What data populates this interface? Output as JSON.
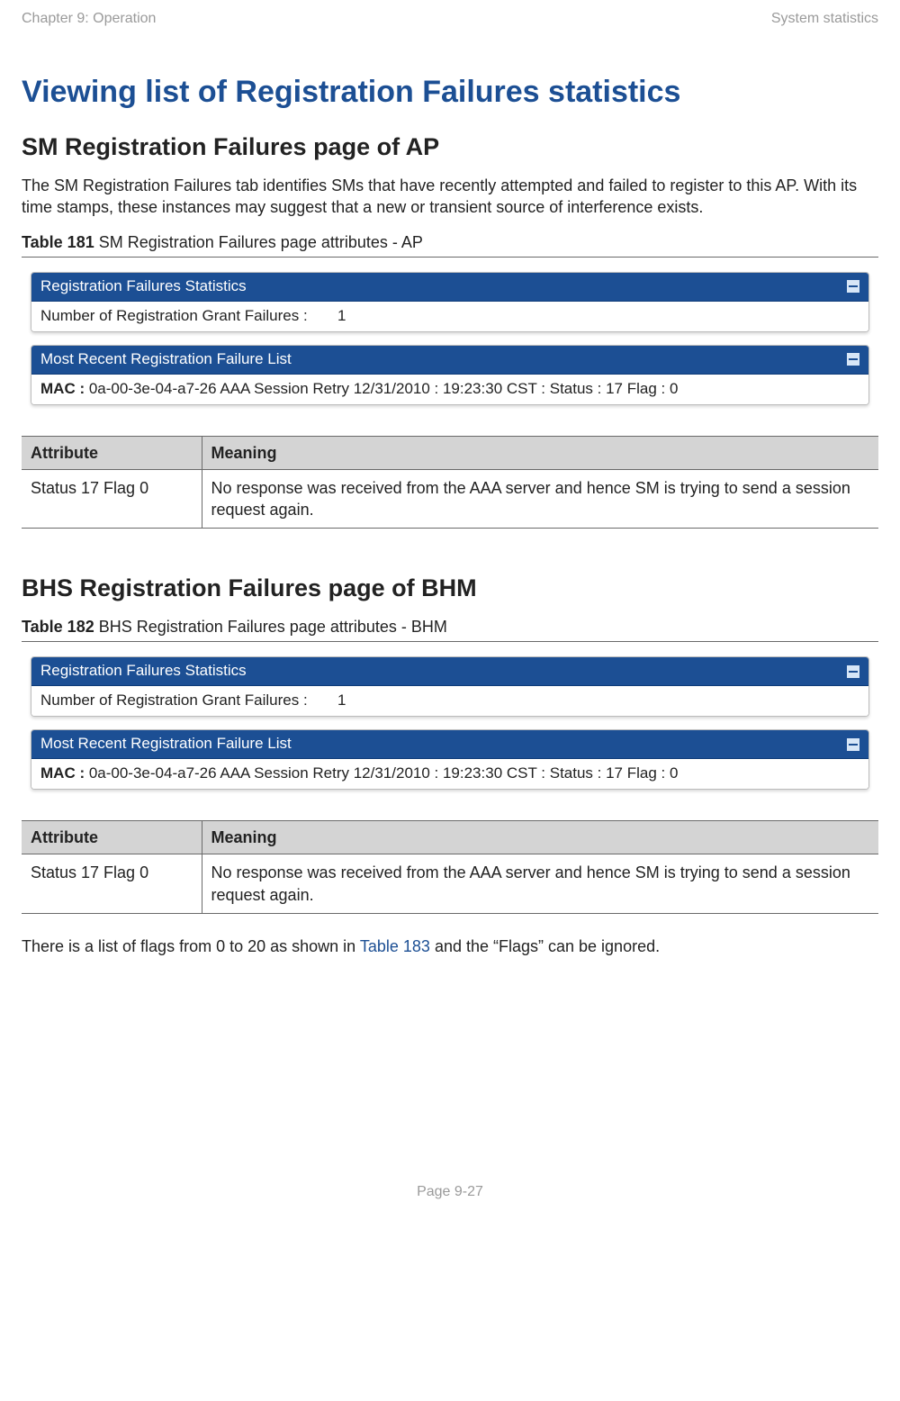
{
  "header": {
    "left": "Chapter 9:  Operation",
    "right": "System statistics"
  },
  "title": "Viewing list of Registration Failures statistics",
  "section1": {
    "heading": "SM Registration Failures page of AP",
    "intro": "The SM Registration Failures tab identifies SMs that have recently attempted and failed to register to this AP. With its time stamps, these instances may suggest that a new or transient source of interference exists.",
    "caption_bold": "Table 181",
    "caption_rest": " SM Registration Failures page attributes - AP",
    "panel1": {
      "title": "Registration Failures Statistics",
      "row_label": "Number of Registration Grant Failures :",
      "row_value": "1"
    },
    "panel2": {
      "title": "Most Recent Registration Failure List",
      "mac_prefix": "MAC :",
      "mac_rest": " 0a-00-3e-04-a7-26 AAA Session Retry 12/31/2010 : 19:23:30 CST : Status : 17 Flag : 0"
    },
    "col_attribute": "Attribute",
    "col_meaning": "Meaning",
    "row_attr": "Status 17 Flag 0",
    "row_meaning": "No response was received from the AAA server and hence SM is trying to send a session request again."
  },
  "section2": {
    "heading": "BHS Registration Failures page of BHM",
    "caption_bold": "Table 182",
    "caption_rest": " BHS Registration Failures page attributes - BHM",
    "panel1": {
      "title": "Registration Failures Statistics",
      "row_label": "Number of Registration Grant Failures :",
      "row_value": "1"
    },
    "panel2": {
      "title": "Most Recent Registration Failure List",
      "mac_prefix": "MAC :",
      "mac_rest": " 0a-00-3e-04-a7-26 AAA Session Retry 12/31/2010 : 19:23:30 CST : Status : 17 Flag : 0"
    },
    "col_attribute": "Attribute",
    "col_meaning": "Meaning",
    "row_attr": "Status 17 Flag 0",
    "row_meaning": "No response was received from the AAA server and hence SM is trying to send a session request again."
  },
  "closing": {
    "pre": "There is a list of flags from 0 to 20 as shown in ",
    "link": "Table 183",
    "post": " and the “Flags” can be ignored."
  },
  "footer": "Page 9-27"
}
